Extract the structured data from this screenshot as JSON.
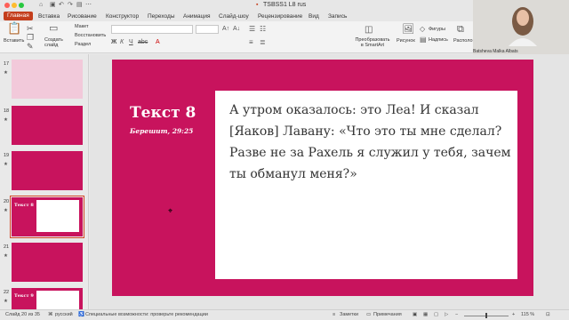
{
  "window": {
    "title": "TSBSS1 L8 rus"
  },
  "ribbon_tabs": [
    "Главная",
    "Вставка",
    "Рисование",
    "Конструктор",
    "Переходы",
    "Анимация",
    "Слайд-шоу",
    "Рецензирование",
    "Вид",
    "Запись"
  ],
  "ribbon": {
    "paste": "Вставить",
    "new_slide": "Создать слайд",
    "layout": "Макет",
    "reset": "Восстановить",
    "section": "Раздел",
    "smartart": "Преобразовать в SmartArt",
    "picture": "Рисунок",
    "shapes": "Фигуры",
    "textbox": "Надпись",
    "arrange": "Располо"
  },
  "webcam": {
    "name": "Batsheva Malka Albats"
  },
  "thumbnails": [
    {
      "num": "17",
      "text": ""
    },
    {
      "num": "18",
      "text": ""
    },
    {
      "num": "19",
      "text": ""
    },
    {
      "num": "20",
      "text": "Текст 8"
    },
    {
      "num": "21",
      "text": ""
    },
    {
      "num": "22",
      "text": "Текст 9"
    }
  ],
  "slide": {
    "title": "Текст 8",
    "subtitle": "Берешит, 29:25",
    "body": "А утром оказалось: это Леа! И сказал [Яаков] Лавану: «Что это ты мне сделал? Разве не за Рахель я служил у тебя, зачем ты обманул меня?»"
  },
  "status": {
    "slide": "Слайд 20 из 35",
    "language": "русский",
    "accessibility": "Специальные возможности: проверьте рекомендации",
    "notes": "Заметки",
    "comments": "Примечания",
    "zoom": "115 %"
  },
  "colors": {
    "accent": "#c43e1c",
    "slide_bg": "#c8135d"
  }
}
